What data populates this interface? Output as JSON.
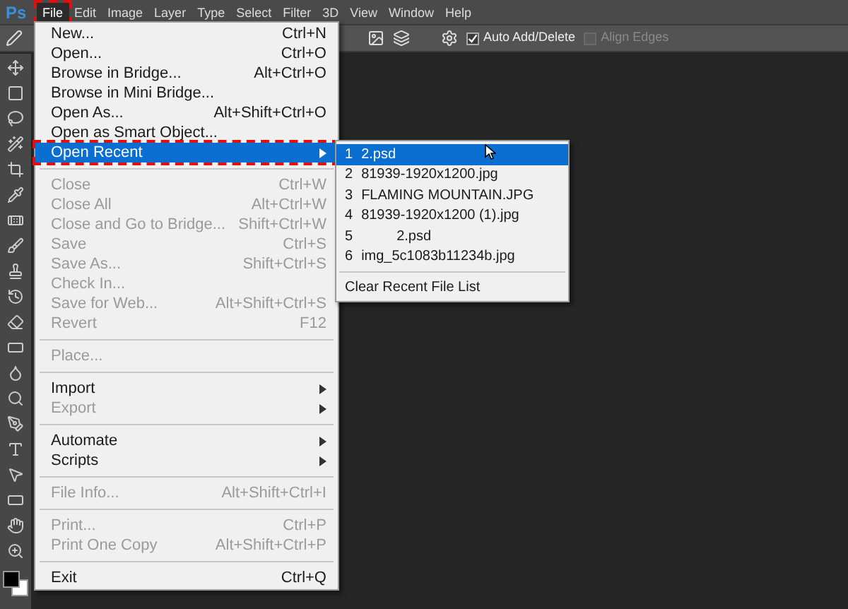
{
  "app_logo": "Ps",
  "menubar": [
    {
      "label": "File",
      "selected": true,
      "marked": true
    },
    {
      "label": "Edit",
      "selected": false,
      "marked": false
    },
    {
      "label": "Image",
      "selected": false,
      "marked": false
    },
    {
      "label": "Layer",
      "selected": false,
      "marked": false
    },
    {
      "label": "Type",
      "selected": false,
      "marked": false
    },
    {
      "label": "Select",
      "selected": false,
      "marked": false
    },
    {
      "label": "Filter",
      "selected": false,
      "marked": false
    },
    {
      "label": "3D",
      "selected": false,
      "marked": false
    },
    {
      "label": "View",
      "selected": false,
      "marked": false
    },
    {
      "label": "Window",
      "selected": false,
      "marked": false
    },
    {
      "label": "Help",
      "selected": false,
      "marked": false
    }
  ],
  "options_bar": {
    "checkboxes": [
      {
        "label": "Auto Add/Delete",
        "checked": true,
        "disabled": false
      },
      {
        "label": "Align Edges",
        "checked": false,
        "disabled": true
      }
    ]
  },
  "file_menu": {
    "groups": [
      [
        {
          "label": "New...",
          "shortcut": "Ctrl+N",
          "disabled": false,
          "selected": false,
          "submenu": false,
          "marked": false
        },
        {
          "label": "Open...",
          "shortcut": "Ctrl+O",
          "disabled": false,
          "selected": false,
          "submenu": false,
          "marked": false
        },
        {
          "label": "Browse in Bridge...",
          "shortcut": "Alt+Ctrl+O",
          "disabled": false,
          "selected": false,
          "submenu": false,
          "marked": false
        },
        {
          "label": "Browse in Mini Bridge...",
          "disabled": false,
          "selected": false,
          "submenu": false,
          "marked": false
        },
        {
          "label": "Open As...",
          "shortcut": "Alt+Shift+Ctrl+O",
          "disabled": false,
          "selected": false,
          "submenu": false,
          "marked": false
        },
        {
          "label": "Open as Smart Object...",
          "disabled": false,
          "selected": false,
          "submenu": false,
          "marked": false
        },
        {
          "label": "Open Recent",
          "disabled": false,
          "selected": true,
          "submenu": true,
          "marked": true
        }
      ],
      [
        {
          "label": "Close",
          "shortcut": "Ctrl+W",
          "disabled": true,
          "selected": false,
          "submenu": false,
          "marked": false
        },
        {
          "label": "Close All",
          "shortcut": "Alt+Ctrl+W",
          "disabled": true,
          "selected": false,
          "submenu": false,
          "marked": false
        },
        {
          "label": "Close and Go to Bridge...",
          "shortcut": "Shift+Ctrl+W",
          "disabled": true,
          "selected": false,
          "submenu": false,
          "marked": false
        },
        {
          "label": "Save",
          "shortcut": "Ctrl+S",
          "disabled": true,
          "selected": false,
          "submenu": false,
          "marked": false
        },
        {
          "label": "Save As...",
          "shortcut": "Shift+Ctrl+S",
          "disabled": true,
          "selected": false,
          "submenu": false,
          "marked": false
        },
        {
          "label": "Check In...",
          "disabled": true,
          "selected": false,
          "submenu": false,
          "marked": false
        },
        {
          "label": "Save for Web...",
          "shortcut": "Alt+Shift+Ctrl+S",
          "disabled": true,
          "selected": false,
          "submenu": false,
          "marked": false
        },
        {
          "label": "Revert",
          "shortcut": "F12",
          "disabled": true,
          "selected": false,
          "submenu": false,
          "marked": false
        }
      ],
      [
        {
          "label": "Place...",
          "disabled": true,
          "selected": false,
          "submenu": false,
          "marked": false
        }
      ],
      [
        {
          "label": "Import",
          "disabled": false,
          "selected": false,
          "submenu": true,
          "marked": false
        },
        {
          "label": "Export",
          "disabled": true,
          "selected": false,
          "submenu": true,
          "marked": false
        }
      ],
      [
        {
          "label": "Automate",
          "disabled": false,
          "selected": false,
          "submenu": true,
          "marked": false
        },
        {
          "label": "Scripts",
          "disabled": false,
          "selected": false,
          "submenu": true,
          "marked": false
        }
      ],
      [
        {
          "label": "File Info...",
          "shortcut": "Alt+Shift+Ctrl+I",
          "disabled": true,
          "selected": false,
          "submenu": false,
          "marked": false
        }
      ],
      [
        {
          "label": "Print...",
          "shortcut": "Ctrl+P",
          "disabled": true,
          "selected": false,
          "submenu": false,
          "marked": false
        },
        {
          "label": "Print One Copy",
          "shortcut": "Alt+Shift+Ctrl+P",
          "disabled": true,
          "selected": false,
          "submenu": false,
          "marked": false
        }
      ],
      [
        {
          "label": "Exit",
          "shortcut": "Ctrl+Q",
          "disabled": false,
          "selected": false,
          "submenu": false,
          "marked": false
        }
      ]
    ]
  },
  "recent_submenu": {
    "files": [
      {
        "number": "1",
        "name": "2.psd",
        "selected": true
      },
      {
        "number": "2",
        "name": "81939-1920x1200.jpg",
        "selected": false
      },
      {
        "number": "3",
        "name": "FLAMING MOUNTAIN.JPG",
        "selected": false
      },
      {
        "number": "4",
        "name": "81939-1920x1200 (1).jpg",
        "selected": false
      },
      {
        "number": "5",
        "name": "         2.psd",
        "selected": false
      },
      {
        "number": "6",
        "name": "img_5c1083b11234b.jpg",
        "selected": false
      }
    ],
    "clear": "Clear Recent File List"
  }
}
